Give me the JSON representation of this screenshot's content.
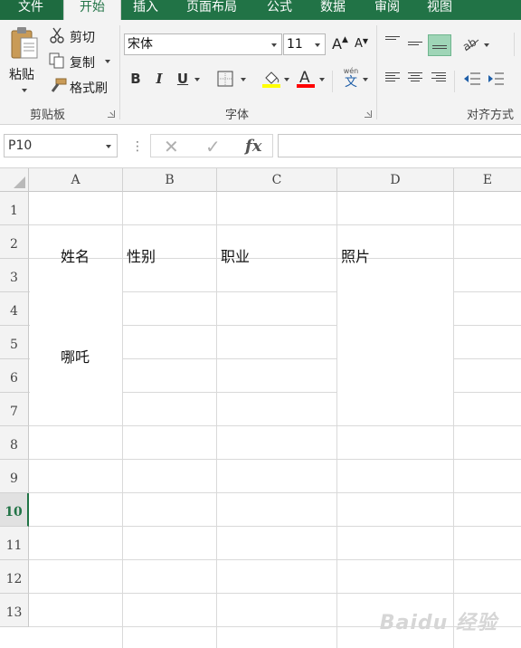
{
  "ribbon_tabs": [
    {
      "label": "文件"
    },
    {
      "label": "开始"
    },
    {
      "label": "插入"
    },
    {
      "label": "页面布局"
    },
    {
      "label": "公式"
    },
    {
      "label": "数据"
    },
    {
      "label": "审阅"
    },
    {
      "label": "视图"
    }
  ],
  "clipboard": {
    "paste_label": "粘贴",
    "cut_label": "剪切",
    "copy_label": "复制",
    "format_painter_label": "格式刷",
    "group_label": "剪贴板"
  },
  "font": {
    "font_name": "宋体",
    "font_size": "11",
    "bold_label": "B",
    "italic_label": "I",
    "underline_label": "U",
    "group_label": "字体",
    "fill_color": "#ffff00",
    "font_color": "#ff0000",
    "wen_label": "wén",
    "wen_char": "文",
    "grow_label": "A",
    "shrink_label": "A"
  },
  "alignment": {
    "group_label": "对齐方式"
  },
  "formula_bar": {
    "name_box": "P10",
    "separator": "⋮",
    "cancel_label": "✕",
    "enter_label": "✓",
    "fx_label": "fx",
    "formula": ""
  },
  "columns": [
    "A",
    "B",
    "C",
    "D",
    "E"
  ],
  "rows": [
    "1",
    "2",
    "3",
    "4",
    "5",
    "6",
    "7",
    "8",
    "9",
    "10",
    "11",
    "12",
    "13"
  ],
  "active_row": "10",
  "cells": {
    "A2": "姓名",
    "B2": "性别",
    "C2": "职业",
    "D2": "照片",
    "A5": "哪吒"
  },
  "watermark": "Baidu 经验",
  "accent_color": "#217346"
}
